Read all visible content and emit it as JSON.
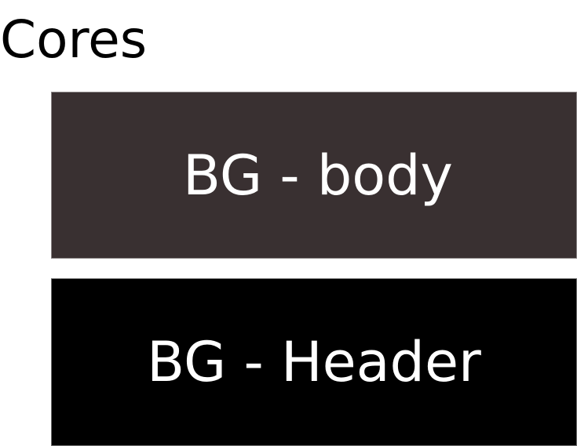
{
  "title": "Cores",
  "swatches": [
    {
      "label": "BG - body",
      "color": "#393031"
    },
    {
      "label": "BG - Header",
      "color": "#000000"
    }
  ]
}
